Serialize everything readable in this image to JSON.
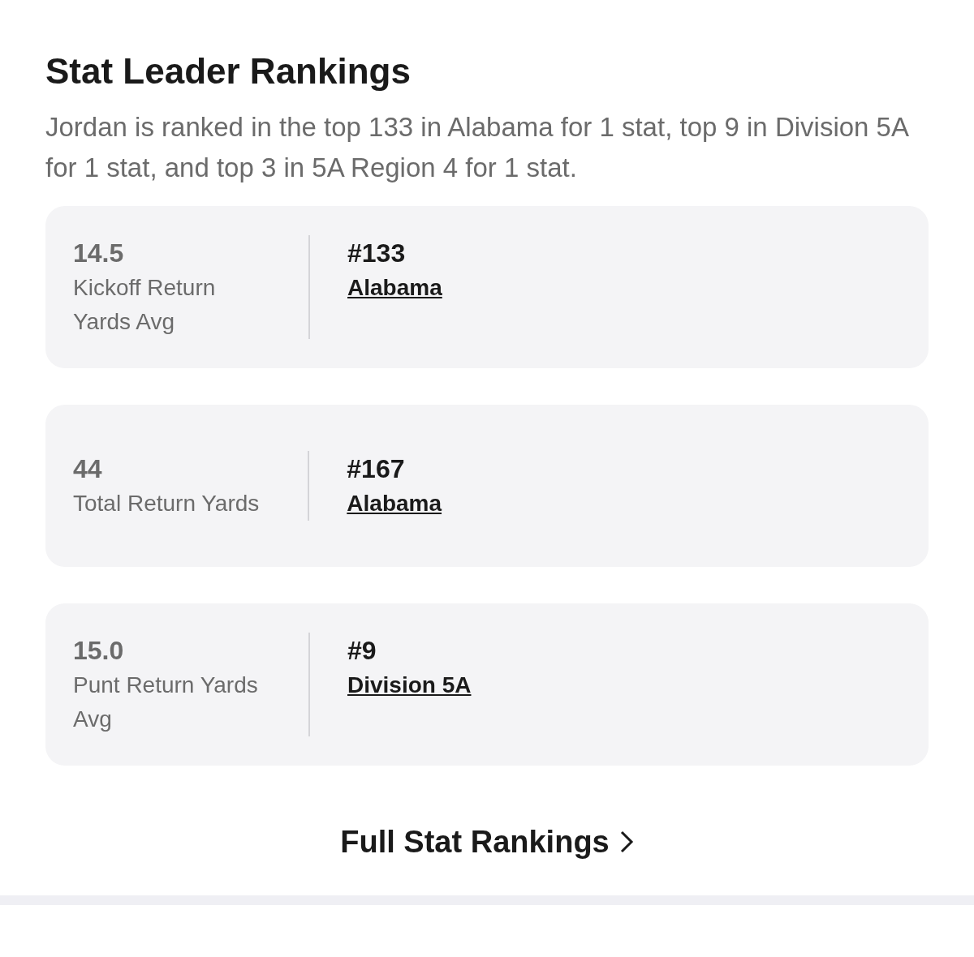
{
  "title": "Stat Leader Rankings",
  "summary": "Jordan is ranked in the top 133 in Alabama for 1 stat, top 9 in Division 5A for 1 stat, and top 3 in 5A Region 4 for 1 stat.",
  "stats": [
    {
      "value": "14.5",
      "label": "Kickoff Return Yards Avg",
      "rank": "#133",
      "region": "Alabama"
    },
    {
      "value": "44",
      "label": "Total Return Yards",
      "rank": "#167",
      "region": "Alabama"
    },
    {
      "value": "15.0",
      "label": "Punt Return Yards Avg",
      "rank": "#9",
      "region": "Division 5A"
    }
  ],
  "full_rankings_link": "Full Stat Rankings"
}
